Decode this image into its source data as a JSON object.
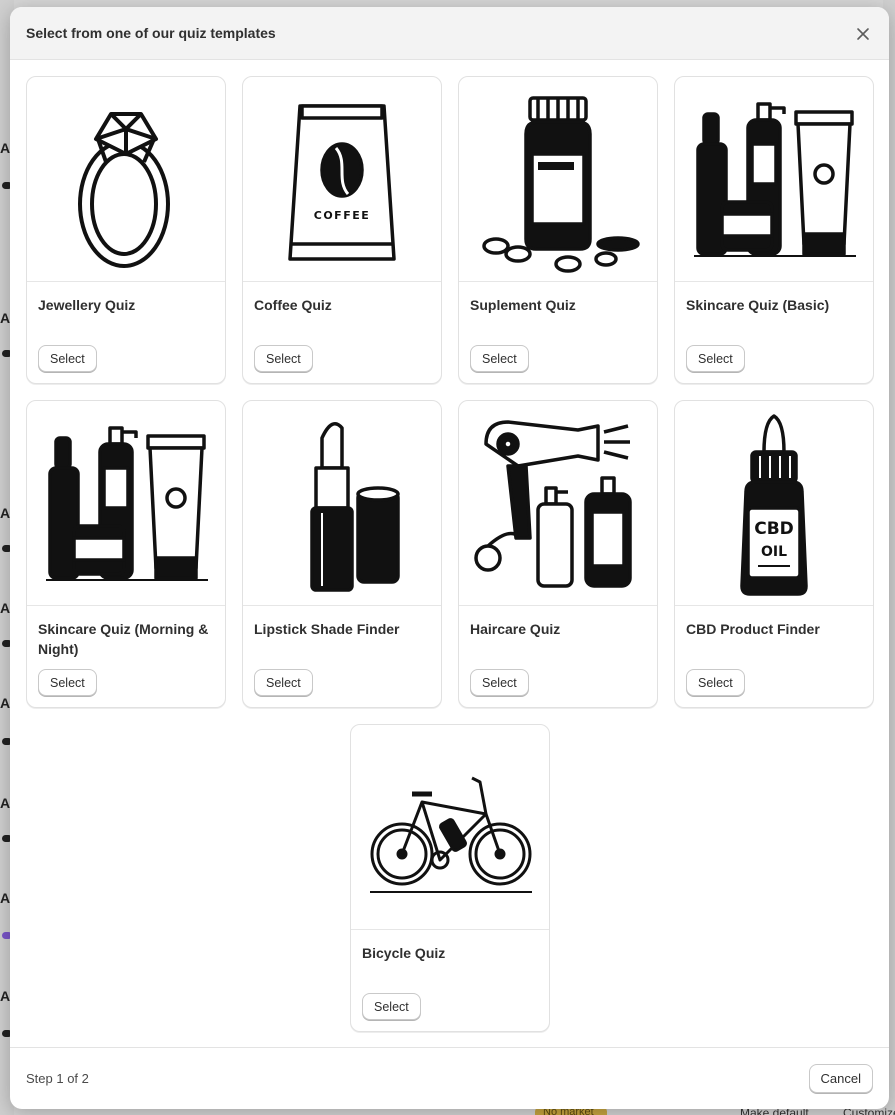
{
  "modal": {
    "title": "Select from one of our quiz templates",
    "close_icon": "close-icon"
  },
  "templates": [
    {
      "title": "Jewellery Quiz",
      "icon": "ring-icon",
      "select_label": "Select"
    },
    {
      "title": "Coffee Quiz",
      "icon": "coffee-bag-icon",
      "select_label": "Select"
    },
    {
      "title": "Suplement Quiz",
      "icon": "supplement-bottle-icon",
      "select_label": "Select"
    },
    {
      "title": "Skincare Quiz (Basic)",
      "icon": "skincare-products-icon",
      "select_label": "Select"
    },
    {
      "title": "Skincare Quiz (Morning & Night)",
      "icon": "skincare-products-icon",
      "select_label": "Select"
    },
    {
      "title": "Lipstick Shade Finder",
      "icon": "lipstick-icon",
      "select_label": "Select"
    },
    {
      "title": "Haircare Quiz",
      "icon": "hair-dryer-icon",
      "select_label": "Select"
    },
    {
      "title": "CBD Product Finder",
      "icon": "cbd-oil-bottle-icon",
      "select_label": "Select"
    },
    {
      "title": "Bicycle Quiz",
      "icon": "bicycle-icon",
      "select_label": "Select"
    }
  ],
  "illustration_text": {
    "coffee": "COFFEE",
    "cbd_line1": "CBD",
    "cbd_line2": "OIL"
  },
  "footer": {
    "step": "Step 1 of 2",
    "cancel_label": "Cancel"
  },
  "background": {
    "badge": "No market",
    "make_default": "Make default",
    "customize": "Customize"
  }
}
